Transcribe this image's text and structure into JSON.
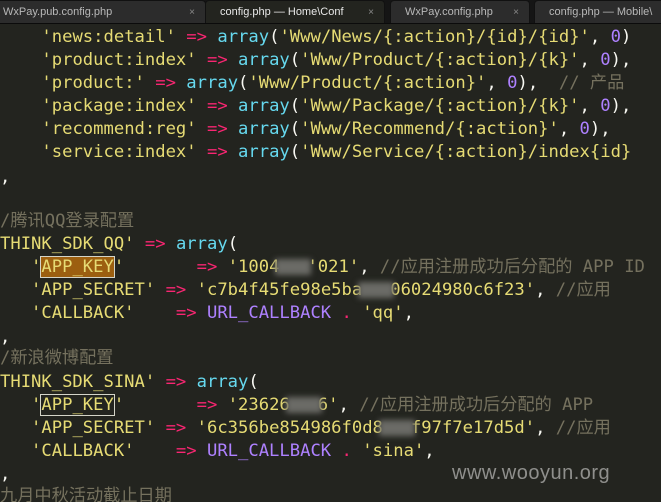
{
  "tabs": [
    {
      "label": "WxPay.pub.config.php",
      "close": "×"
    },
    {
      "label": "config.php — Home\\Conf",
      "close": "×"
    },
    {
      "label": "WxPay.config.php",
      "close": "×"
    },
    {
      "label": "config.php — Mobile\\",
      "close": ""
    }
  ],
  "code": {
    "r1": {
      "a": "'news:detail'",
      "b": " => ",
      "c": "array",
      "d": "(",
      "e": "'Www/News/{:action}/{id}/{id}'",
      "f": ", ",
      "g": "0",
      "h": ")"
    },
    "r2": {
      "a": "'product:index'",
      "b": " => ",
      "c": "array",
      "d": "(",
      "e": "'Www/Product/{:action}/{k}'",
      "f": ", ",
      "g": "0",
      "h": "),"
    },
    "r3": {
      "a": "'product:'",
      "b": " => ",
      "c": "array",
      "d": "(",
      "e": "'Www/Product/{:action}'",
      "f": ", ",
      "g": "0",
      "h": "),  ",
      "i": "// 产品"
    },
    "r4": {
      "a": "'package:index'",
      "b": " => ",
      "c": "array",
      "d": "(",
      "e": "'Www/Package/{:action}/{k}'",
      "f": ", ",
      "g": "0",
      "h": "),"
    },
    "r5": {
      "a": "'recommend:reg'",
      "b": " => ",
      "c": "array",
      "d": "(",
      "e": "'Www/Recommend/{:action}'",
      "f": ", ",
      "g": "0",
      "h": "),"
    },
    "r6": {
      "a": "'service:index'",
      "b": " => ",
      "c": "array",
      "d": "(",
      "e": "'Www/Service/{:action}/index{id}"
    },
    "r7": {
      "a": ","
    },
    "r8": {
      "a": "/腾讯QQ登录配置"
    },
    "r9": {
      "a": "THINK_SDK_QQ'",
      "b": " => ",
      "c": "array",
      "d": "("
    },
    "r10": {
      "q1": "'",
      "k": "APP_KEY",
      "q2": "'",
      "b": "       => ",
      "s1": "'1004",
      "s2": "'021'",
      "f": ", ",
      "cm": "//应用注册成功后分配的 APP ID"
    },
    "r11": {
      "a": "'APP_SECRET'",
      "b": " => ",
      "s1": "'c7b4f45fe98e5ba",
      "s2": "06024980c6f23'",
      "f": ", ",
      "cm": "//应用"
    },
    "r12": {
      "a": "'CALLBACK'",
      "b": "    => ",
      "ct": "URL_CALLBACK",
      "dot": " . ",
      "s": "'qq'",
      "f": ","
    },
    "r13": {
      "a": ","
    },
    "r14": {
      "a": "/新浪微博配置"
    },
    "r15": {
      "a": "THINK_SDK_SINA'",
      "b": " => ",
      "c": "array",
      "d": "("
    },
    "r16": {
      "q1": "'",
      "k": "APP_KEY",
      "q2": "'",
      "b": "       => ",
      "s1": "'23626",
      "s2": "6'",
      "f": ", ",
      "cm": "//应用注册成功后分配的 APP"
    },
    "r17": {
      "a": "'APP_SECRET'",
      "b": " => ",
      "s1": "'6c356be854986f0d8",
      "s2": "f97f7e17d5d'",
      "f": ", ",
      "cm": "//应用"
    },
    "r18": {
      "a": "'CALLBACK'",
      "b": "    => ",
      "ct": "URL_CALLBACK",
      "dot": " . ",
      "s": "'sina'",
      "f": ","
    },
    "r19": {
      "a": ","
    },
    "r20": {
      "a": "九月中秋活动截止日期"
    }
  },
  "watermark": "www.wooyun.org",
  "colors": {
    "background": "#23241f",
    "string": "#e6db74",
    "operator": "#f92672",
    "function": "#66d9ef",
    "number": "#ae81ff",
    "comment": "#75715e"
  }
}
